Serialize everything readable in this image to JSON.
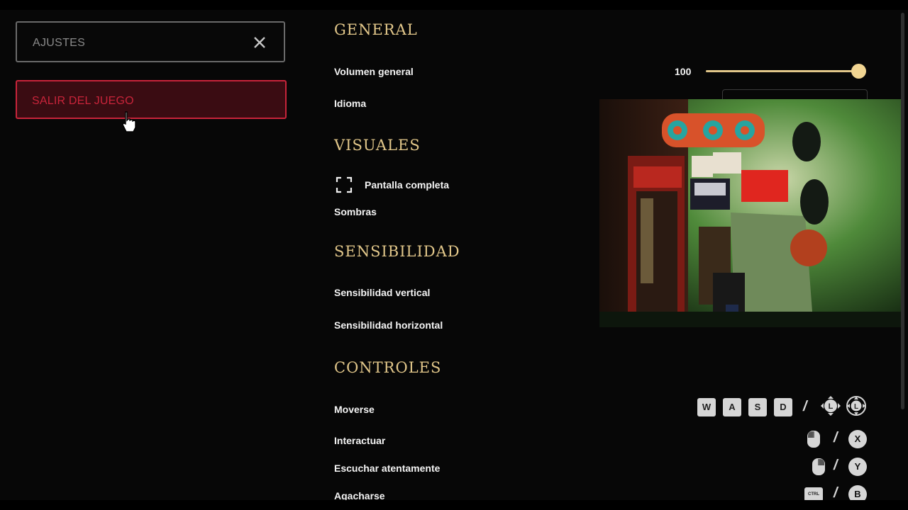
{
  "menu": {
    "search_label": "AJUSTES",
    "exit_label": "SALIR DEL JUEGO"
  },
  "sections": {
    "general": {
      "title": "GENERAL",
      "volume_label": "Volumen general",
      "volume_value": "100",
      "volume_level": 1.0,
      "language_label": "Idioma"
    },
    "visuals": {
      "title": "VISUALES",
      "fullscreen_label": "Pantalla completa",
      "shadows_label": "Sombras"
    },
    "sensitivity": {
      "title": "SENSIBILIDAD",
      "vertical_label": "Sensibilidad vertical",
      "horizontal_label": "Sensibilidad horizontal"
    },
    "controls": {
      "title": "CONTROLES",
      "move_label": "Moverse",
      "move_keys": [
        "W",
        "A",
        "S",
        "D"
      ],
      "move_stick_left": "L",
      "move_stick_right": "L",
      "interact_label": "Interactuar",
      "interact_button": "X",
      "listen_label": "Escuchar atentamente",
      "listen_button": "Y",
      "crouch_label": "Agacharse",
      "crouch_key": "CTRL",
      "crouch_button": "B",
      "separator": "/"
    }
  },
  "colors": {
    "accent": "#e2c78a",
    "danger": "#c8243a",
    "background": "#070707"
  },
  "icons": {
    "close": "close-icon",
    "fullscreen": "fullscreen-icon",
    "mouse": "mouse-icon",
    "cursor": "hand-cursor-icon"
  }
}
